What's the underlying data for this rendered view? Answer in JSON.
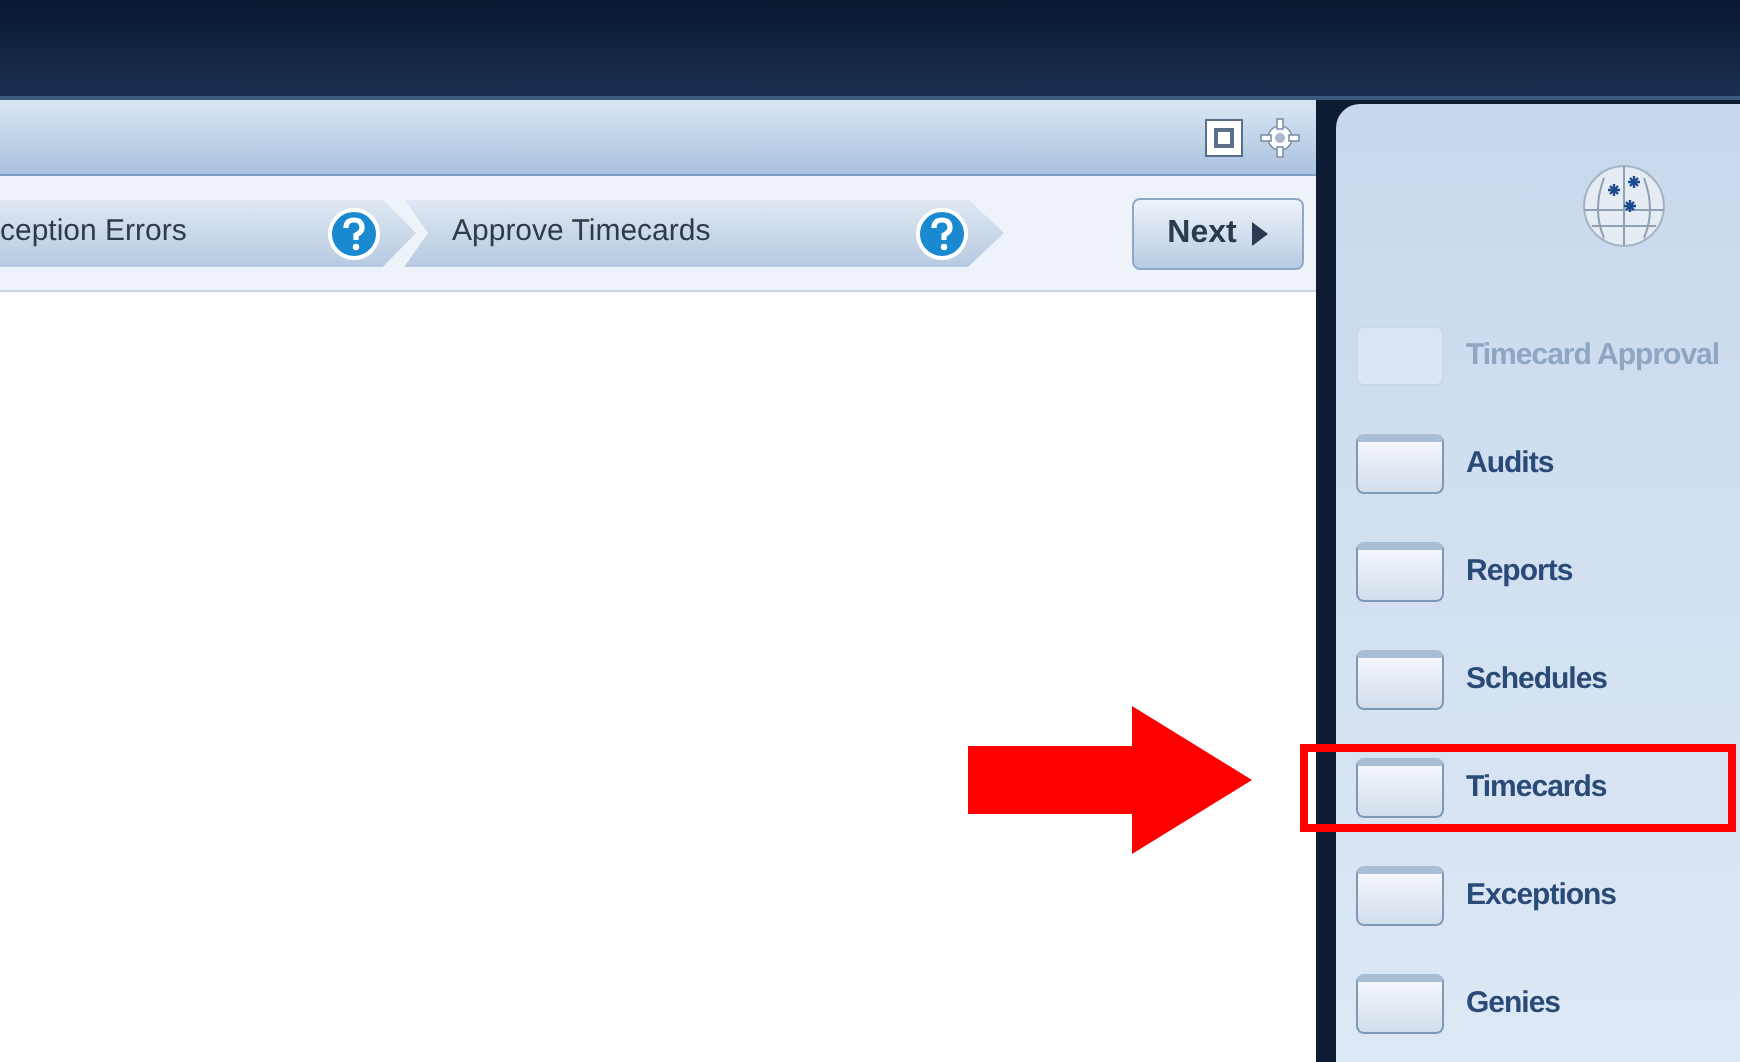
{
  "workflow": {
    "steps": [
      {
        "label": "ception Errors"
      },
      {
        "label": "Approve Timecards"
      }
    ],
    "next_button": "Next"
  },
  "sidebar": {
    "items": [
      {
        "label": "Timecard Approval",
        "disabled": true,
        "highlighted": false
      },
      {
        "label": "Audits",
        "disabled": false,
        "highlighted": false
      },
      {
        "label": "Reports",
        "disabled": false,
        "highlighted": false
      },
      {
        "label": "Schedules",
        "disabled": false,
        "highlighted": false
      },
      {
        "label": "Timecards",
        "disabled": false,
        "highlighted": true
      },
      {
        "label": "Exceptions",
        "disabled": false,
        "highlighted": false
      },
      {
        "label": "Genies",
        "disabled": false,
        "highlighted": false
      }
    ]
  }
}
